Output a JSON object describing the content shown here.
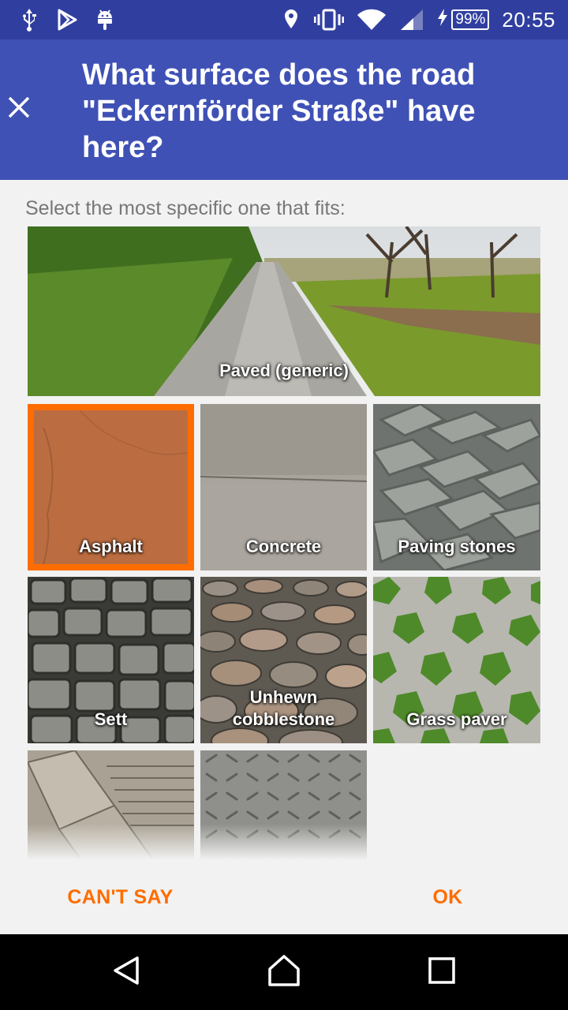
{
  "status_bar": {
    "icons_left": [
      "usb-icon",
      "play-store-icon",
      "android-icon"
    ],
    "icons_right": [
      "location-icon",
      "vibrate-icon",
      "wifi-icon",
      "signal-icon"
    ],
    "battery": "99%",
    "time": "20:55"
  },
  "app_bar": {
    "title": "What surface does the road \"Eckernförder Straße\" have here?",
    "close_icon": "close-icon"
  },
  "content": {
    "hint": "Select the most specific one that fits:",
    "options": [
      {
        "label": "Paved (generic)",
        "selected": false
      },
      {
        "label": "Asphalt",
        "selected": true
      },
      {
        "label": "Concrete",
        "selected": false
      },
      {
        "label": "Paving stones",
        "selected": false
      },
      {
        "label": "Sett",
        "selected": false
      },
      {
        "label": "Unhewn cobblestone",
        "selected": false
      },
      {
        "label": "Grass paver",
        "selected": false
      },
      {
        "label": "",
        "selected": false
      },
      {
        "label": "",
        "selected": false
      }
    ]
  },
  "buttons": {
    "cant_say": "CAN'T SAY",
    "ok": "OK"
  },
  "colors": {
    "status_bar": "#303f9f",
    "app_bar": "#3f51b5",
    "accent": "#ff6d00"
  }
}
